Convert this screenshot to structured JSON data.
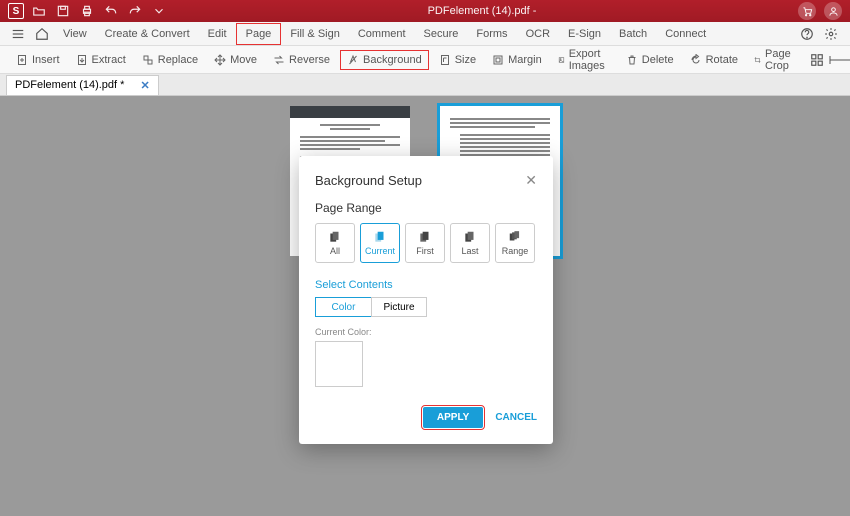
{
  "titlebar": {
    "logo": "S",
    "title": "PDFelement (14).pdf -"
  },
  "menu": {
    "items": [
      "View",
      "Create & Convert",
      "Edit",
      "Page",
      "Fill & Sign",
      "Comment",
      "Secure",
      "Forms",
      "OCR",
      "E-Sign",
      "Batch",
      "Connect"
    ],
    "highlighted": "Page"
  },
  "toolbar": {
    "insert": "Insert",
    "extract": "Extract",
    "replace": "Replace",
    "move": "Move",
    "reverse": "Reverse",
    "background": "Background",
    "size": "Size",
    "margin": "Margin",
    "exportimg": "Export Images",
    "delete": "Delete",
    "rotate": "Rotate",
    "pagecrop": "Page Crop"
  },
  "tab": {
    "name": "PDFelement (14).pdf *"
  },
  "dialog": {
    "title": "Background Setup",
    "page_range": "Page Range",
    "ranges": {
      "all": "All",
      "current": "Current",
      "first": "First",
      "last": "Last",
      "range": "Range"
    },
    "select_contents": "Select Contents",
    "color": "Color",
    "picture": "Picture",
    "current_color": "Current Color:",
    "apply": "APPLY",
    "cancel": "CANCEL"
  }
}
